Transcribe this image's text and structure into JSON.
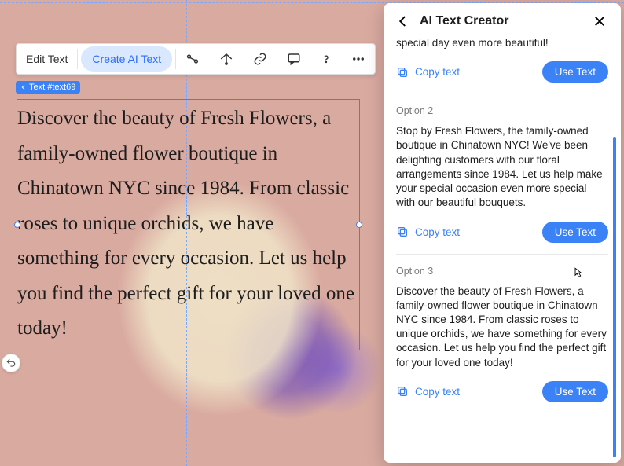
{
  "toolbar": {
    "edit_text_label": "Edit Text",
    "create_ai_text_label": "Create AI Text"
  },
  "element_tag": "Text #text69",
  "canvas_text": "Discover the beauty of Fresh Flowers, a family-owned flower boutique in Chinatown NYC since 1984. From classic roses to unique orchids, we have something for every occasion. Let us help you find the perfect gift for your loved one today!",
  "ai_panel": {
    "title": "AI Text Creator",
    "options": [
      {
        "label": "",
        "body_tail": "special day even more beautiful!",
        "copy_label": "Copy text",
        "use_label": "Use Text"
      },
      {
        "label": "Option 2",
        "body": "Stop by Fresh Flowers, the family-owned boutique in Chinatown NYC! We've been delighting customers with our floral arrangements since 1984. Let us help make your special occasion even more special with our beautiful bouquets.",
        "copy_label": "Copy text",
        "use_label": "Use Text"
      },
      {
        "label": "Option 3",
        "body": "Discover the beauty of Fresh Flowers, a family-owned flower boutique in Chinatown NYC since 1984. From classic roses to unique orchids, we have something for every occasion. Let us help you find the perfect gift for your loved one today!",
        "copy_label": "Copy text",
        "use_label": "Use Text"
      }
    ]
  }
}
